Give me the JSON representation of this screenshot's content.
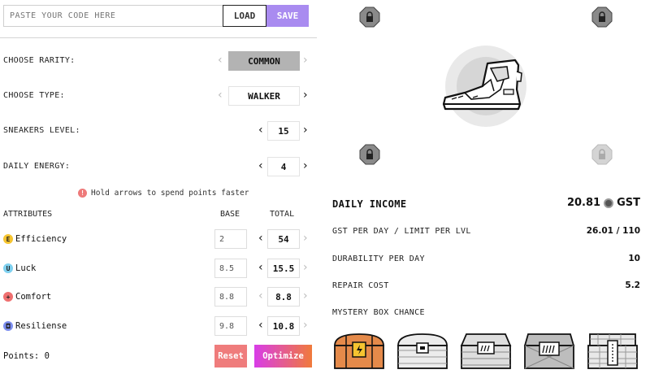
{
  "code_bar": {
    "placeholder": "PASTE YOUR CODE HERE",
    "load_label": "LOAD",
    "save_label": "SAVE"
  },
  "selectors": {
    "rarity": {
      "label": "CHOOSE RARITY:",
      "value": "COMMON"
    },
    "type": {
      "label": "CHOOSE TYPE:",
      "value": "WALKER"
    },
    "level": {
      "label": "SNEAKERS LEVEL:",
      "value": "15"
    },
    "energy": {
      "label": "DAILY ENERGY:",
      "value": "4"
    }
  },
  "hint": {
    "icon": "!",
    "text": "Hold arrows to spend points faster"
  },
  "attributes": {
    "header": "ATTRIBUTES",
    "base_header": "BASE",
    "total_header": "TOTAL",
    "items": [
      {
        "name": "Efficiency",
        "icon": "E",
        "color": "#f5c430",
        "base": "2",
        "total": "54"
      },
      {
        "name": "Luck",
        "icon": "U",
        "color": "#7fd0ef",
        "base": "8.5",
        "total": "15.5"
      },
      {
        "name": "Comfort",
        "icon": "+",
        "color": "#ef6f6f",
        "base": "8.8",
        "total": "8.8"
      },
      {
        "name": "Resiliense",
        "icon": "◘",
        "color": "#7d8ff0",
        "base": "9.8",
        "total": "10.8"
      }
    ]
  },
  "points": "Points: 0",
  "actions": {
    "reset": "Reset",
    "optimize": "Optimize"
  },
  "stats": {
    "daily_income_label": "DAILY INCOME",
    "daily_income_value": "20.81",
    "daily_income_unit": "GST",
    "gst_per_day_label": "GST PER DAY / LIMIT PER LVL",
    "gst_per_day_value": "26.01 / 110",
    "durability_label": "DURABILITY PER DAY",
    "durability_value": "10",
    "repair_label": "REPAIR COST",
    "repair_value": "5.2",
    "mystery_label": "MYSTERY BOX CHANCE"
  },
  "colors": {
    "accent": "#a98bf0",
    "reset": "#ef7c7c",
    "optimize_from": "#d83de8",
    "optimize_to": "#f07a3b"
  }
}
